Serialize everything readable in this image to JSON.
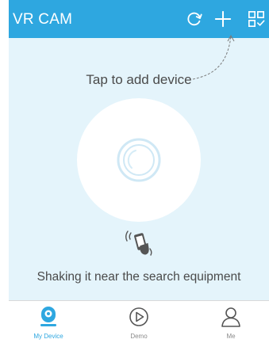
{
  "colors": {
    "accent": "#2ea7e0",
    "background": "#e4f4fb",
    "text": "#4a4a4a",
    "tab_inactive": "#8a8a8a"
  },
  "header": {
    "title": "VR CAM",
    "actions": [
      {
        "icon": "refresh-icon"
      },
      {
        "icon": "plus-icon"
      },
      {
        "icon": "qr-scan-icon"
      }
    ]
  },
  "main": {
    "hint_text": "Tap to add device",
    "add_button_icon": "add-device-circle-icon",
    "shake_icon": "shake-phone-icon",
    "shake_text": "Shaking it near the search equipment"
  },
  "tabbar": {
    "tabs": [
      {
        "label": "My Device",
        "icon": "camera-icon",
        "active": true
      },
      {
        "label": "Demo",
        "icon": "play-icon",
        "active": false
      },
      {
        "label": "Me",
        "icon": "person-icon",
        "active": false
      }
    ]
  }
}
